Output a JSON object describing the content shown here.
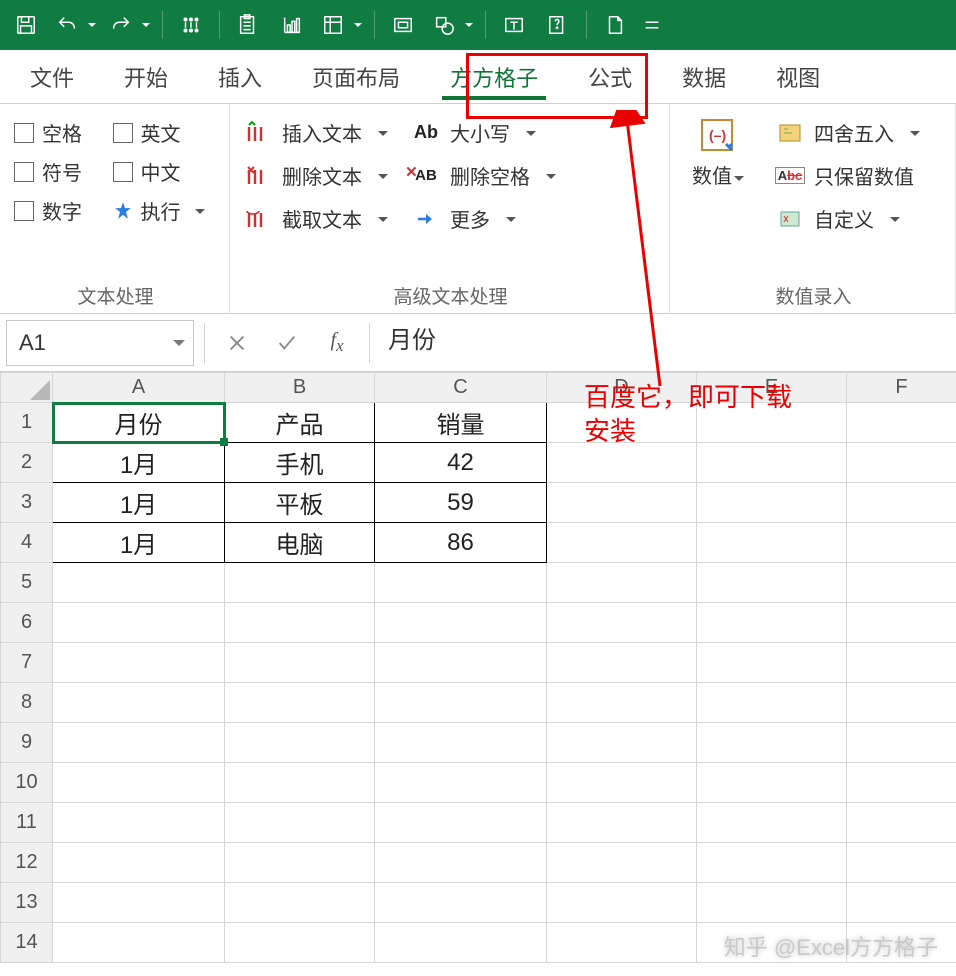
{
  "qat_icons": [
    "save",
    "undo",
    "redo",
    "touch",
    "paste",
    "chart",
    "pivot",
    "screenshot",
    "shape",
    "text-box",
    "help",
    "page"
  ],
  "tabs": [
    {
      "label": "文件"
    },
    {
      "label": "开始"
    },
    {
      "label": "插入"
    },
    {
      "label": "页面布局"
    },
    {
      "label": "方方格子",
      "active": true
    },
    {
      "label": "公式"
    },
    {
      "label": "数据"
    },
    {
      "label": "视图"
    }
  ],
  "ribbon": {
    "group1": {
      "label": "文本处理",
      "checks": [
        {
          "label": "空格"
        },
        {
          "label": "英文"
        },
        {
          "label": "符号"
        },
        {
          "label": "中文"
        },
        {
          "label": "数字"
        },
        {
          "label": "执行",
          "exec": true
        }
      ]
    },
    "group2": {
      "label": "高级文本处理",
      "left": [
        {
          "icon": "insert-text",
          "label": "插入文本"
        },
        {
          "icon": "delete-text",
          "label": "删除文本"
        },
        {
          "icon": "extract-text",
          "label": "截取文本"
        }
      ],
      "right": [
        {
          "icon": "case",
          "label": "大小写"
        },
        {
          "icon": "trim",
          "label": "删除空格"
        },
        {
          "icon": "more",
          "label": "更多"
        }
      ]
    },
    "group3": {
      "label": "数值录入",
      "big": {
        "label": "数值"
      },
      "items": [
        {
          "icon": "round",
          "label": "四舍五入"
        },
        {
          "icon": "keepnum",
          "label": "只保留数值"
        },
        {
          "icon": "custom",
          "label": "自定义"
        }
      ]
    }
  },
  "namebox": "A1",
  "formula_value": "月份",
  "annotation": {
    "line1": "百度它，即可下载",
    "line2": "安装"
  },
  "columns": [
    "A",
    "B",
    "C",
    "D",
    "E",
    "F"
  ],
  "rows": [
    "1",
    "2",
    "3",
    "4",
    "5",
    "6",
    "7",
    "8",
    "9",
    "10",
    "11",
    "12",
    "13",
    "14"
  ],
  "data": [
    [
      "月份",
      "产品",
      "销量"
    ],
    [
      "1月",
      "手机",
      "42"
    ],
    [
      "1月",
      "平板",
      "59"
    ],
    [
      "1月",
      "电脑",
      "86"
    ]
  ],
  "watermark": "知乎 @Excel方方格子"
}
